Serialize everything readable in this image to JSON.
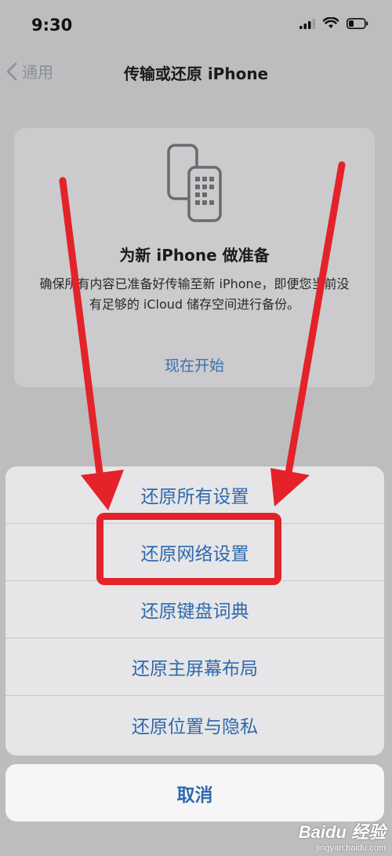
{
  "status_bar": {
    "time": "9:30",
    "icons": [
      "cellular-signal-icon",
      "wifi-icon",
      "battery-icon"
    ]
  },
  "nav": {
    "back_label": "通用",
    "title": "传输或还原 iPhone"
  },
  "card": {
    "icon": "phones-transfer-icon",
    "title": "为新 iPhone 做准备",
    "description": "确保所有内容已准备好传输至新 iPhone，即便您当前没有足够的 iCloud 储存空间进行备份。",
    "link": "现在开始"
  },
  "action_sheet": {
    "items": [
      "还原所有设置",
      "还原网络设置",
      "还原键盘词典",
      "还原主屏幕布局",
      "还原位置与隐私"
    ],
    "highlighted_index": 1,
    "cancel": "取消"
  },
  "colors": {
    "accent": "#2f69ad",
    "annotation": "#e3222a"
  },
  "watermark": {
    "logo": "Baidu 经验",
    "sub": "jingyan.baidu.com"
  }
}
